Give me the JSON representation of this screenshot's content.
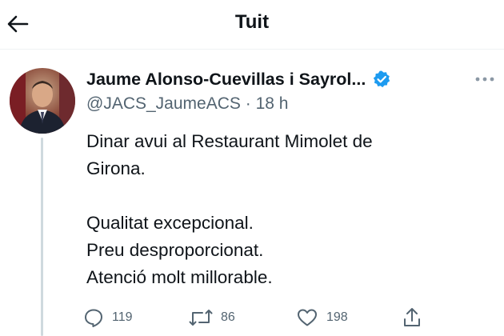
{
  "header": {
    "title": "Tuit",
    "back_icon": "arrow-left-icon"
  },
  "tweet": {
    "author": {
      "display_name": "Jaume Alonso-Cuevillas i Sayrol...",
      "handle": "@JACS_JaumeACS",
      "separator": "·",
      "time": "18 h",
      "verified_icon": "verified-badge-icon",
      "verified_color": "#1d9bf0"
    },
    "more_icon": "more-horizontal-icon",
    "text": "Dinar avui al Restaurant Mimolet de\nGirona.\n\nQualitat excepcional.\nPreu desproporcionat.\nAtenció molt millorable.",
    "actions": {
      "replies": "119",
      "retweets": "86",
      "likes": "198",
      "reply_icon": "reply-icon",
      "retweet_icon": "retweet-icon",
      "like_icon": "heart-icon",
      "share_icon": "share-icon"
    }
  },
  "colors": {
    "text_primary": "#0f1419",
    "text_secondary": "#536471",
    "accent": "#1d9bf0",
    "thread_line": "#cfd9de"
  }
}
